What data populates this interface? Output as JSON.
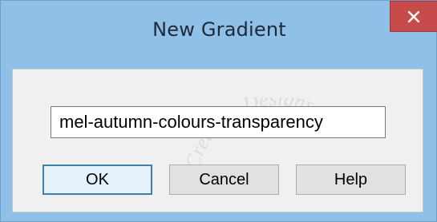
{
  "window": {
    "title": "New Gradient",
    "close_glyph": "✕"
  },
  "form": {
    "name_value": "mel-autumn-colours-transparency"
  },
  "buttons": {
    "ok_label": "OK",
    "cancel_label": "Cancel",
    "help_label": "Help"
  },
  "watermark": {
    "text": "Creative-Designs"
  },
  "colors": {
    "window_frame": "#8ec0e8",
    "close_button": "#c74b4b",
    "client_area": "#f0f0f0",
    "default_button_border": "#3c7fb1"
  }
}
